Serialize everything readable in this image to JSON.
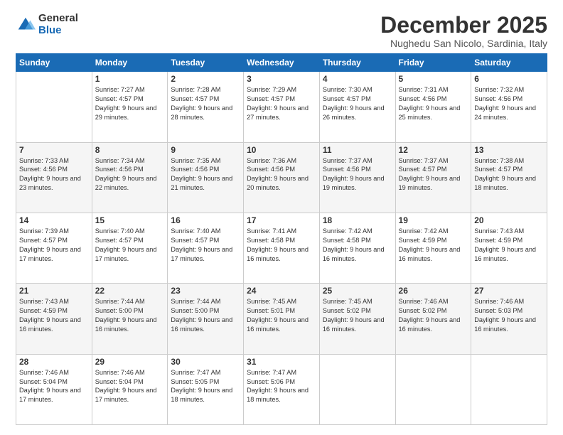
{
  "logo": {
    "general": "General",
    "blue": "Blue"
  },
  "title": "December 2025",
  "subtitle": "Nughedu San Nicolo, Sardinia, Italy",
  "days": [
    "Sunday",
    "Monday",
    "Tuesday",
    "Wednesday",
    "Thursday",
    "Friday",
    "Saturday"
  ],
  "weeks": [
    [
      {
        "num": "",
        "sunrise": "",
        "sunset": "",
        "daylight": ""
      },
      {
        "num": "1",
        "sunrise": "Sunrise: 7:27 AM",
        "sunset": "Sunset: 4:57 PM",
        "daylight": "Daylight: 9 hours and 29 minutes."
      },
      {
        "num": "2",
        "sunrise": "Sunrise: 7:28 AM",
        "sunset": "Sunset: 4:57 PM",
        "daylight": "Daylight: 9 hours and 28 minutes."
      },
      {
        "num": "3",
        "sunrise": "Sunrise: 7:29 AM",
        "sunset": "Sunset: 4:57 PM",
        "daylight": "Daylight: 9 hours and 27 minutes."
      },
      {
        "num": "4",
        "sunrise": "Sunrise: 7:30 AM",
        "sunset": "Sunset: 4:57 PM",
        "daylight": "Daylight: 9 hours and 26 minutes."
      },
      {
        "num": "5",
        "sunrise": "Sunrise: 7:31 AM",
        "sunset": "Sunset: 4:56 PM",
        "daylight": "Daylight: 9 hours and 25 minutes."
      },
      {
        "num": "6",
        "sunrise": "Sunrise: 7:32 AM",
        "sunset": "Sunset: 4:56 PM",
        "daylight": "Daylight: 9 hours and 24 minutes."
      }
    ],
    [
      {
        "num": "7",
        "sunrise": "Sunrise: 7:33 AM",
        "sunset": "Sunset: 4:56 PM",
        "daylight": "Daylight: 9 hours and 23 minutes."
      },
      {
        "num": "8",
        "sunrise": "Sunrise: 7:34 AM",
        "sunset": "Sunset: 4:56 PM",
        "daylight": "Daylight: 9 hours and 22 minutes."
      },
      {
        "num": "9",
        "sunrise": "Sunrise: 7:35 AM",
        "sunset": "Sunset: 4:56 PM",
        "daylight": "Daylight: 9 hours and 21 minutes."
      },
      {
        "num": "10",
        "sunrise": "Sunrise: 7:36 AM",
        "sunset": "Sunset: 4:56 PM",
        "daylight": "Daylight: 9 hours and 20 minutes."
      },
      {
        "num": "11",
        "sunrise": "Sunrise: 7:37 AM",
        "sunset": "Sunset: 4:56 PM",
        "daylight": "Daylight: 9 hours and 19 minutes."
      },
      {
        "num": "12",
        "sunrise": "Sunrise: 7:37 AM",
        "sunset": "Sunset: 4:57 PM",
        "daylight": "Daylight: 9 hours and 19 minutes."
      },
      {
        "num": "13",
        "sunrise": "Sunrise: 7:38 AM",
        "sunset": "Sunset: 4:57 PM",
        "daylight": "Daylight: 9 hours and 18 minutes."
      }
    ],
    [
      {
        "num": "14",
        "sunrise": "Sunrise: 7:39 AM",
        "sunset": "Sunset: 4:57 PM",
        "daylight": "Daylight: 9 hours and 17 minutes."
      },
      {
        "num": "15",
        "sunrise": "Sunrise: 7:40 AM",
        "sunset": "Sunset: 4:57 PM",
        "daylight": "Daylight: 9 hours and 17 minutes."
      },
      {
        "num": "16",
        "sunrise": "Sunrise: 7:40 AM",
        "sunset": "Sunset: 4:57 PM",
        "daylight": "Daylight: 9 hours and 17 minutes."
      },
      {
        "num": "17",
        "sunrise": "Sunrise: 7:41 AM",
        "sunset": "Sunset: 4:58 PM",
        "daylight": "Daylight: 9 hours and 16 minutes."
      },
      {
        "num": "18",
        "sunrise": "Sunrise: 7:42 AM",
        "sunset": "Sunset: 4:58 PM",
        "daylight": "Daylight: 9 hours and 16 minutes."
      },
      {
        "num": "19",
        "sunrise": "Sunrise: 7:42 AM",
        "sunset": "Sunset: 4:59 PM",
        "daylight": "Daylight: 9 hours and 16 minutes."
      },
      {
        "num": "20",
        "sunrise": "Sunrise: 7:43 AM",
        "sunset": "Sunset: 4:59 PM",
        "daylight": "Daylight: 9 hours and 16 minutes."
      }
    ],
    [
      {
        "num": "21",
        "sunrise": "Sunrise: 7:43 AM",
        "sunset": "Sunset: 4:59 PM",
        "daylight": "Daylight: 9 hours and 16 minutes."
      },
      {
        "num": "22",
        "sunrise": "Sunrise: 7:44 AM",
        "sunset": "Sunset: 5:00 PM",
        "daylight": "Daylight: 9 hours and 16 minutes."
      },
      {
        "num": "23",
        "sunrise": "Sunrise: 7:44 AM",
        "sunset": "Sunset: 5:00 PM",
        "daylight": "Daylight: 9 hours and 16 minutes."
      },
      {
        "num": "24",
        "sunrise": "Sunrise: 7:45 AM",
        "sunset": "Sunset: 5:01 PM",
        "daylight": "Daylight: 9 hours and 16 minutes."
      },
      {
        "num": "25",
        "sunrise": "Sunrise: 7:45 AM",
        "sunset": "Sunset: 5:02 PM",
        "daylight": "Daylight: 9 hours and 16 minutes."
      },
      {
        "num": "26",
        "sunrise": "Sunrise: 7:46 AM",
        "sunset": "Sunset: 5:02 PM",
        "daylight": "Daylight: 9 hours and 16 minutes."
      },
      {
        "num": "27",
        "sunrise": "Sunrise: 7:46 AM",
        "sunset": "Sunset: 5:03 PM",
        "daylight": "Daylight: 9 hours and 16 minutes."
      }
    ],
    [
      {
        "num": "28",
        "sunrise": "Sunrise: 7:46 AM",
        "sunset": "Sunset: 5:04 PM",
        "daylight": "Daylight: 9 hours and 17 minutes."
      },
      {
        "num": "29",
        "sunrise": "Sunrise: 7:46 AM",
        "sunset": "Sunset: 5:04 PM",
        "daylight": "Daylight: 9 hours and 17 minutes."
      },
      {
        "num": "30",
        "sunrise": "Sunrise: 7:47 AM",
        "sunset": "Sunset: 5:05 PM",
        "daylight": "Daylight: 9 hours and 18 minutes."
      },
      {
        "num": "31",
        "sunrise": "Sunrise: 7:47 AM",
        "sunset": "Sunset: 5:06 PM",
        "daylight": "Daylight: 9 hours and 18 minutes."
      },
      {
        "num": "",
        "sunrise": "",
        "sunset": "",
        "daylight": ""
      },
      {
        "num": "",
        "sunrise": "",
        "sunset": "",
        "daylight": ""
      },
      {
        "num": "",
        "sunrise": "",
        "sunset": "",
        "daylight": ""
      }
    ]
  ]
}
